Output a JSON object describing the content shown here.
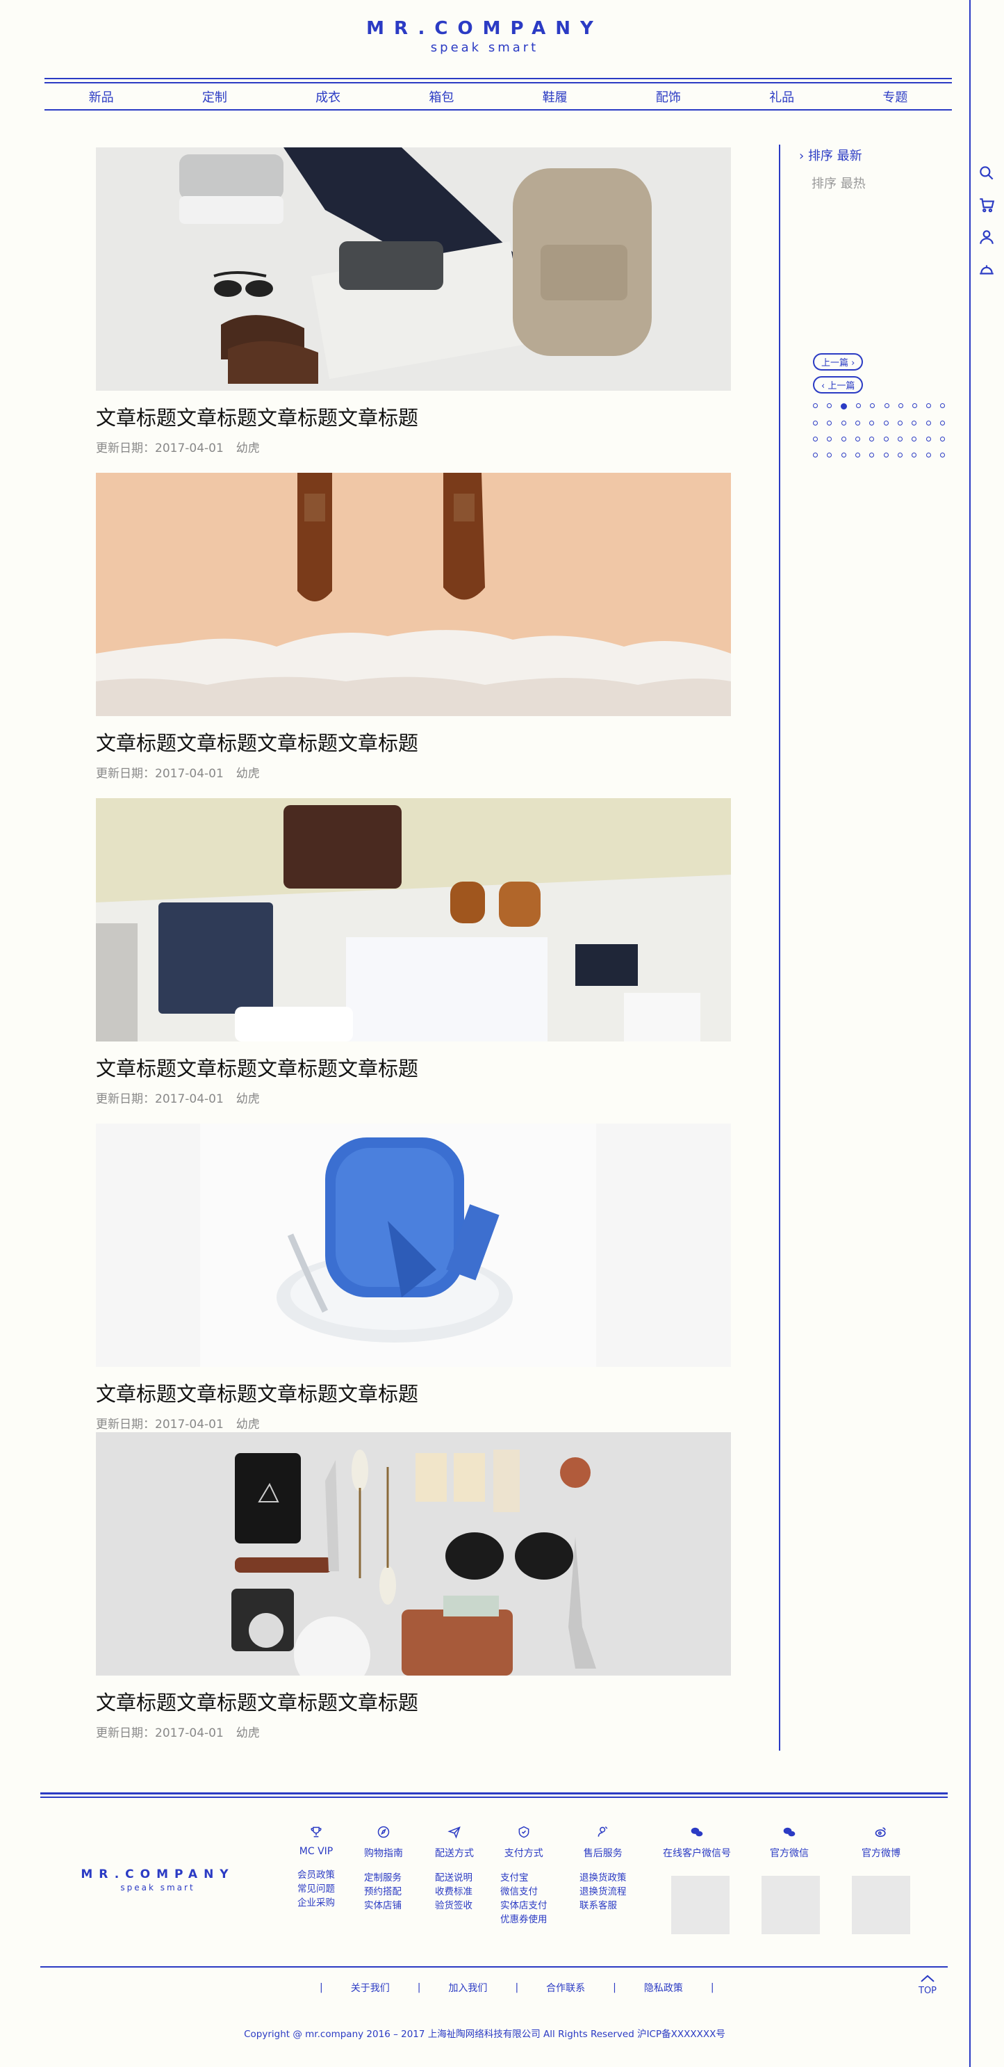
{
  "header": {
    "logo": "MR.COMPANY",
    "tagline": "speak smart"
  },
  "nav": {
    "items": [
      "新品",
      "定制",
      "成衣",
      "箱包",
      "鞋履",
      "配饰",
      "礼品",
      "专题"
    ]
  },
  "articles": [
    {
      "title": "文章标题文章标题文章标题文章标题",
      "date_label": "更新日期：2017-04-01",
      "author": "幼虎"
    },
    {
      "title": "文章标题文章标题文章标题文章标题",
      "date_label": "更新日期：2017-04-01",
      "author": "幼虎"
    },
    {
      "title": "文章标题文章标题文章标题文章标题",
      "date_label": "更新日期：2017-04-01",
      "author": "幼虎"
    },
    {
      "title": "文章标题文章标题文章标题文章标题",
      "date_label": "更新日期：2017-04-01",
      "author": "幼虎"
    },
    {
      "title": "文章标题文章标题文章标题文章标题",
      "date_label": "更新日期：2017-04-01",
      "author": "幼虎"
    }
  ],
  "sidebar": {
    "sort_latest": "排序 最新",
    "sort_hot": "排序 最热",
    "prev": "上一篇",
    "next": "上一篇"
  },
  "side_tools": [
    "search-icon",
    "cart-icon",
    "user-icon",
    "service-icon"
  ],
  "footer": {
    "logo": "MR.COMPANY",
    "tagline": "speak smart",
    "columns": [
      {
        "icon": "trophy-icon",
        "head": "MC VIP",
        "links": [
          "会员政策",
          "常见问题",
          "企业采购"
        ]
      },
      {
        "icon": "compass-icon",
        "head": "购物指南",
        "links": [
          "定制服务",
          "预约搭配",
          "实体店铺"
        ]
      },
      {
        "icon": "plane-icon",
        "head": "配送方式",
        "links": [
          "配送说明",
          "收费标准",
          "验货签收"
        ]
      },
      {
        "icon": "shield-icon",
        "head": "支付方式",
        "links": [
          "支付宝",
          "微信支付",
          "实体店支付",
          "优惠券使用"
        ]
      },
      {
        "icon": "person-icon",
        "head": "售后服务",
        "links": [
          "退换货政策",
          "退换货流程",
          "联系客服"
        ]
      }
    ],
    "qr": [
      {
        "icon": "wechat-icon",
        "head": "在线客户微信号"
      },
      {
        "icon": "wechat-icon",
        "head": "官方微信"
      },
      {
        "icon": "weibo-icon",
        "head": "官方微博"
      }
    ],
    "bottom_links": [
      "关于我们",
      "加入我们",
      "合作联系",
      "隐私政策"
    ],
    "top_label": "TOP",
    "copyright": "Copyright @ mr.company 2016 – 2017 上海祉陶网络科技有限公司  All Rights Reserved    沪ICP备XXXXXXX号"
  },
  "colors": {
    "accent": "#2b3bc4",
    "background": "#fdfdf8"
  }
}
